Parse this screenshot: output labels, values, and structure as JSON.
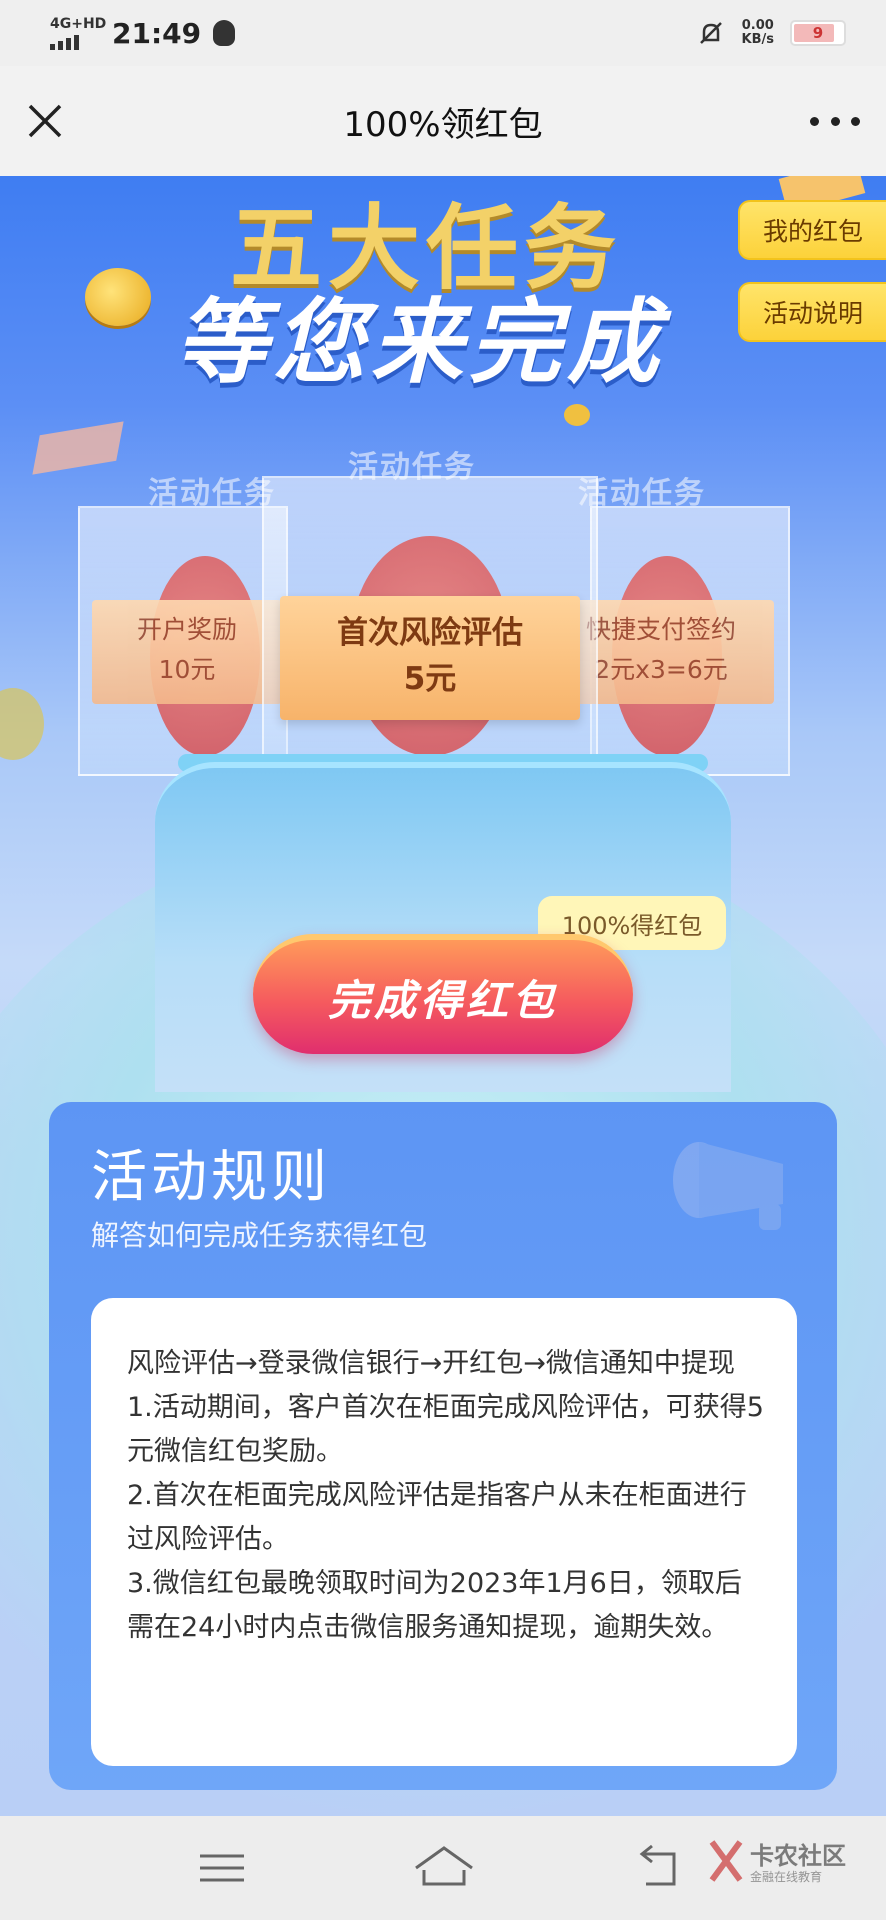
{
  "status_bar": {
    "network": "4G+HD",
    "time": "21:49",
    "speed_value": "0.00",
    "speed_unit": "KB/s",
    "battery": "9"
  },
  "titlebar": {
    "title": "100%领红包",
    "close_icon": "close-icon",
    "more_icon": "more-icon"
  },
  "hero": {
    "title_line1": "五大任务",
    "title_line2": "等您来完成",
    "my_red_packet": "我的红包",
    "activity_desc": "活动说明"
  },
  "tasks": {
    "box_label": "活动任务",
    "items": [
      {
        "title": "开户奖励",
        "reward": "10元"
      },
      {
        "title": "首次风险评估",
        "reward": "5元"
      },
      {
        "title": "快捷支付签约",
        "reward": "2元x3=6元"
      }
    ]
  },
  "cta": {
    "badge": "100%得红包",
    "label": "完成得红包"
  },
  "rules": {
    "title": "活动规则",
    "subtitle": "解答如何完成任务获得红包",
    "body": [
      "风险评估→登录微信银行→开红包→微信通知中提现",
      "1.活动期间，客户首次在柜面完成风险评估，可获得5元微信红包奖励。",
      "2.首次在柜面完成风险评估是指客户从未在柜面进行过风险评估。",
      "3.微信红包最晚领取时间为2023年1月6日，领取后需在24小时内点击微信服务通知提现，逾期失效。"
    ]
  },
  "navbar": {
    "watermark_title": "卡农社区",
    "watermark_sub": "金融在线教育"
  },
  "colors": {
    "primary_blue": "#3f7df2",
    "gold": "#f3d168",
    "cta_red": "#e02e6e",
    "button_yellow": "#fcd23a"
  }
}
